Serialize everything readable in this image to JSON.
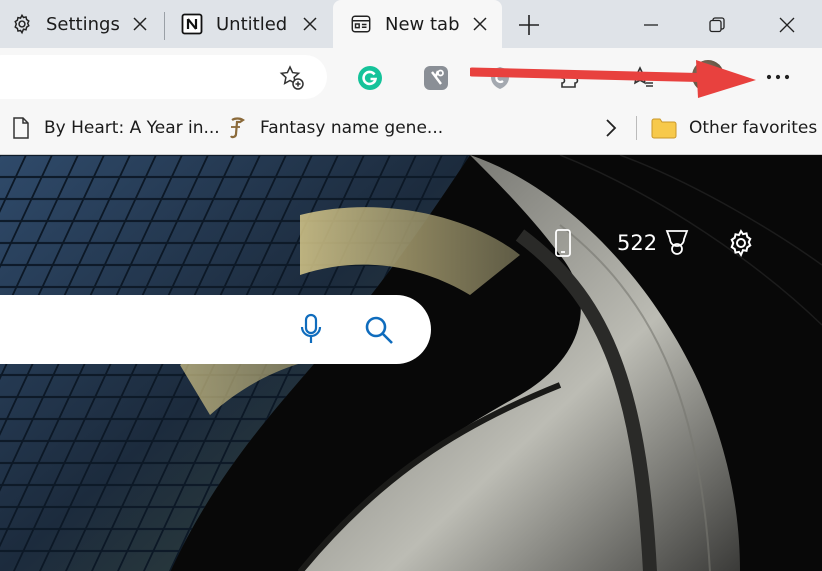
{
  "tabs": [
    {
      "label": "Settings",
      "icon": "gear-icon"
    },
    {
      "label": "Untitled",
      "icon": "notion-icon"
    },
    {
      "label": "New tab",
      "icon": "new-tab-page-icon",
      "active": true
    }
  ],
  "favorites": [
    {
      "label": "By Heart: A Year in...",
      "icon": "page-icon"
    },
    {
      "label": "Fantasy name gene...",
      "icon": "fantasy-site-icon"
    },
    {
      "label": "Other favorites",
      "icon": "folder-icon"
    }
  ],
  "new_tab_page": {
    "points": "522"
  },
  "colors": {
    "tabstrip_bg": "#dfe3e8",
    "toolbar_bg": "#f7f7f7",
    "accent_blue": "#0f6cbd",
    "grammarly_green": "#15c39a",
    "annotation_red": "#e8413e"
  }
}
